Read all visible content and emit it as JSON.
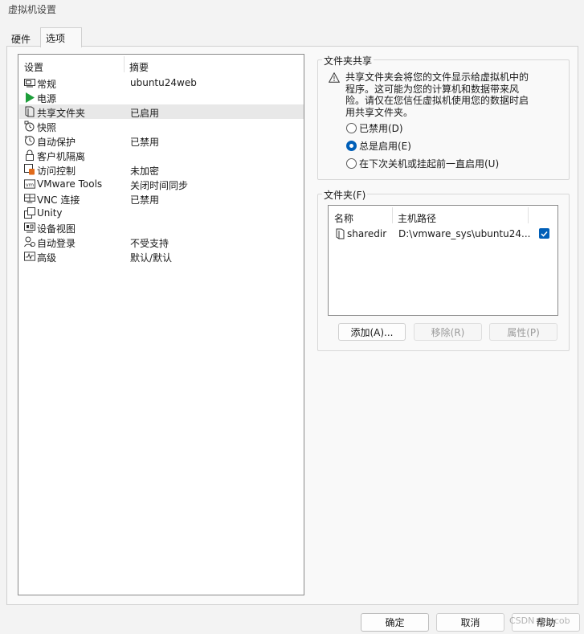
{
  "window": {
    "title": "虚拟机设置"
  },
  "tabs": [
    {
      "label": "硬件"
    },
    {
      "label": "选项"
    }
  ],
  "settings": {
    "header": {
      "col1": "设置",
      "col2": "摘要"
    },
    "items": [
      {
        "name": "常规",
        "summary": "ubuntu24web",
        "icon": "general-icon"
      },
      {
        "name": "电源",
        "summary": "",
        "icon": "power-play-icon"
      },
      {
        "name": "共享文件夹",
        "summary": "已启用",
        "icon": "shared-folder-icon",
        "selected": true
      },
      {
        "name": "快照",
        "summary": "",
        "icon": "snapshot-icon"
      },
      {
        "name": "自动保护",
        "summary": "已禁用",
        "icon": "autoprotect-icon"
      },
      {
        "name": "客户机隔离",
        "summary": "",
        "icon": "lock-icon"
      },
      {
        "name": "访问控制",
        "summary": "未加密",
        "icon": "access-control-icon"
      },
      {
        "name": "VMware Tools",
        "summary": "关闭时间同步",
        "icon": "vmware-tools-icon"
      },
      {
        "name": "VNC 连接",
        "summary": "已禁用",
        "icon": "vnc-icon"
      },
      {
        "name": "Unity",
        "summary": "",
        "icon": "unity-icon"
      },
      {
        "name": "设备视图",
        "summary": "",
        "icon": "device-view-icon"
      },
      {
        "name": "自动登录",
        "summary": "不受支持",
        "icon": "autologin-icon"
      },
      {
        "name": "高级",
        "summary": "默认/默认",
        "icon": "advanced-icon"
      }
    ]
  },
  "folder_sharing": {
    "title": "文件夹共享",
    "warning": "共享文件夹会将您的文件显示给虚拟机中的程序。这可能为您的计算机和数据带来风险。请仅在您信任虚拟机使用您的数据时启用共享文件夹。",
    "options": [
      {
        "label": "已禁用(D)",
        "checked": false
      },
      {
        "label": "总是启用(E)",
        "checked": true
      },
      {
        "label": "在下次关机或挂起前一直启用(U)",
        "checked": false
      }
    ]
  },
  "folders": {
    "title": "文件夹(F)",
    "columns": {
      "name": "名称",
      "host_path": "主机路径"
    },
    "rows": [
      {
        "name": "sharedir",
        "host_path": "D:\\vmware_sys\\ubuntu24...",
        "enabled": true
      }
    ],
    "buttons": {
      "add": "添加(A)...",
      "remove": "移除(R)",
      "properties": "属性(P)"
    }
  },
  "footer": {
    "ok": "确定",
    "cancel": "取消",
    "help": "帮助"
  },
  "watermark": "CSDN @Jacob",
  "colors": {
    "accent": "#005fb8",
    "play": "#1e9e3a",
    "selected_row": "#e8e8e8"
  }
}
